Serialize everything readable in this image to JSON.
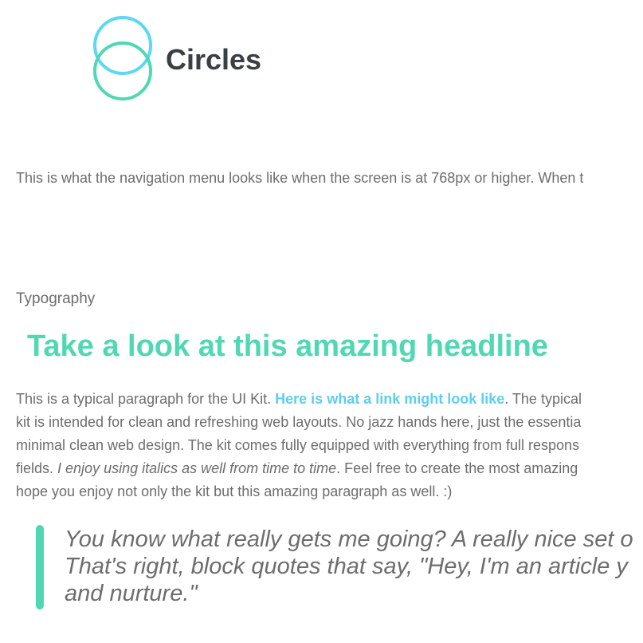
{
  "brand": {
    "name": "Circles",
    "logo_colors": {
      "top_ring": "#5ad8f6",
      "bottom_ring": "#4fd8b3"
    }
  },
  "nav_note": "This is what the navigation menu looks like when the screen is at 768px or higher. When t",
  "typography": {
    "section_label": "Typography",
    "headline": "Take a look at this amazing headline",
    "paragraph": {
      "line1_before_link": "This is a typical paragraph for the UI Kit. ",
      "link_text": "Here is what a link might look like",
      "line1_after_link": ". The typical",
      "line2": "kit is intended for clean and refreshing web layouts. No jazz hands here, just the essentia",
      "line3": "minimal clean web design. The kit comes fully equipped with everything from full respons",
      "line4_before_italic": "fields. ",
      "italic_text": "I enjoy using italics as well from time to time",
      "line4_after_italic": ". Feel free to create the most amazing",
      "line5": "hope you enjoy not only the kit but this amazing paragraph as well. :)"
    },
    "blockquote": {
      "line1": "You know what really gets me going? A really nice set o",
      "line2": "That's right, block quotes that say, \"Hey, I'm an article y",
      "line3": "and nurture.\""
    }
  },
  "colors": {
    "accent_green": "#4fd8b3",
    "link_blue": "#5ccfee",
    "body_text": "#6d6d6d",
    "brand_text": "#3a3f45"
  }
}
